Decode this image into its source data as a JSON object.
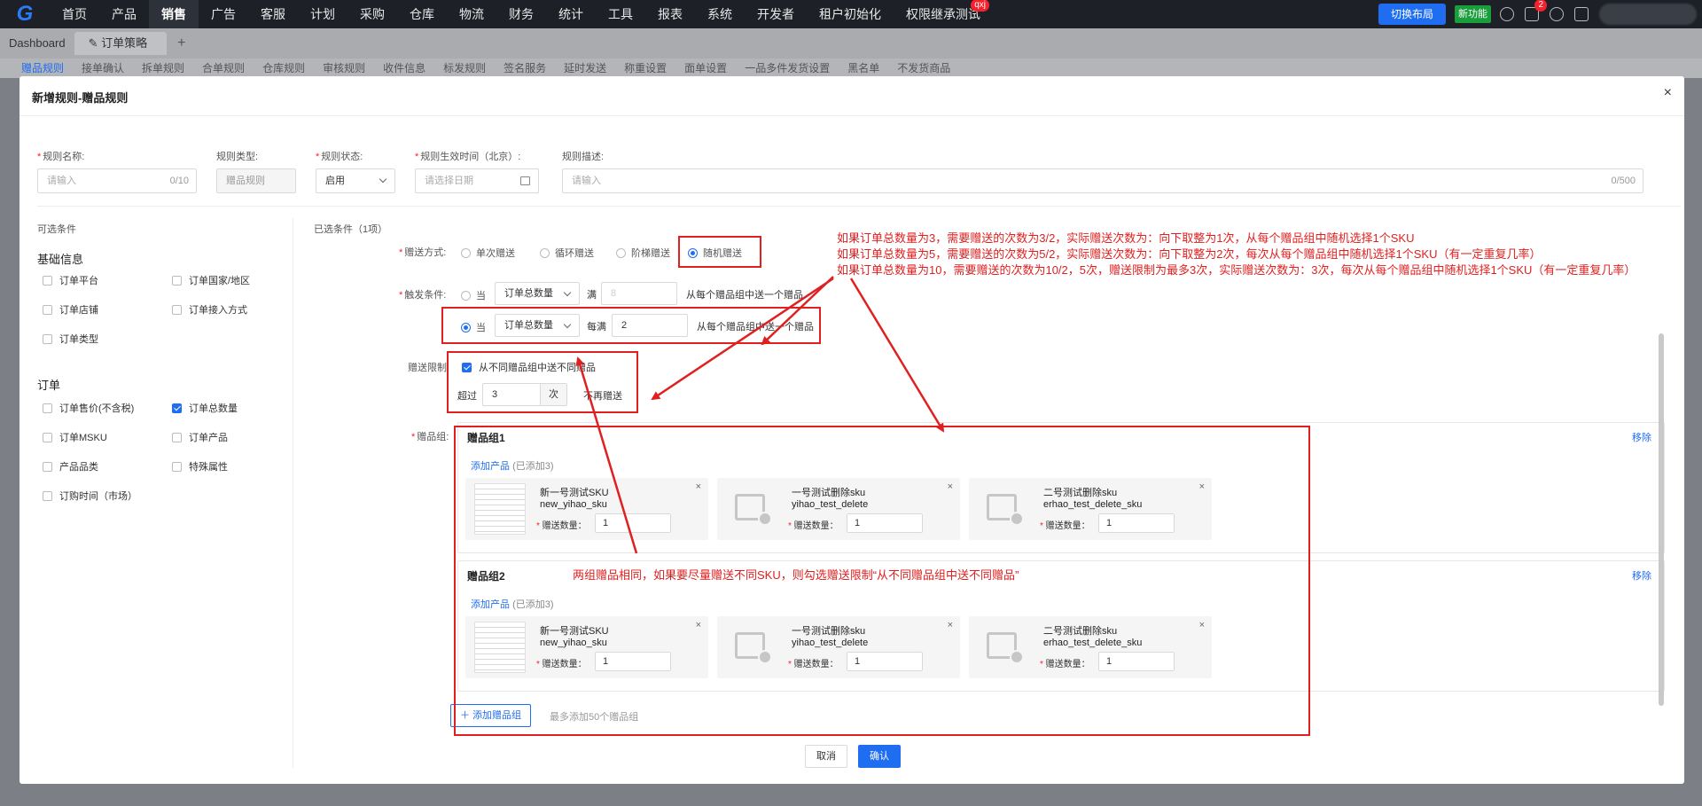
{
  "topnav": {
    "items": [
      "首页",
      "产品",
      "销售",
      "广告",
      "客服",
      "计划",
      "采购",
      "仓库",
      "物流",
      "财务",
      "统计",
      "工具",
      "报表",
      "系统",
      "开发者",
      "租户初始化",
      "权限继承测试"
    ],
    "active_index": 2,
    "badge_label": "qxj",
    "switch_layout_label": "切换布局",
    "new_feature_label": "新功能",
    "notify_count": "2"
  },
  "tabs": {
    "items": [
      "Dashboard",
      "订单策略"
    ],
    "active_index": 1,
    "add_label": "+"
  },
  "subtabs": [
    "赠品规则",
    "接单确认",
    "拆单规则",
    "合单规则",
    "仓库规则",
    "审核规则",
    "收件信息",
    "标发规则",
    "签名服务",
    "延时发送",
    "称重设置",
    "面单设置",
    "一品多件发货设置",
    "黑名单",
    "不发货商品"
  ],
  "modal": {
    "title": "新增规则-赠品规则",
    "close_label": "×",
    "fields": {
      "rule_name": {
        "label": "规则名称:",
        "placeholder": "请输入",
        "counter": "0/10"
      },
      "rule_type": {
        "label": "规则类型:",
        "value": "赠品规则"
      },
      "rule_status": {
        "label": "规则状态:",
        "value": "启用"
      },
      "effective_time": {
        "label": "规则生效时间（北京）:",
        "placeholder": "请选择日期"
      },
      "rule_desc": {
        "label": "规则描述:",
        "placeholder": "请输入",
        "counter": "0/500"
      }
    },
    "sidebar": {
      "title": "可选条件",
      "groups": [
        {
          "name": "基础信息",
          "items": [
            {
              "label": "订单平台",
              "checked": false
            },
            {
              "label": "订单国家/地区",
              "checked": false
            },
            {
              "label": "订单店铺",
              "checked": false
            },
            {
              "label": "订单接入方式",
              "checked": false
            },
            {
              "label": "订单类型",
              "checked": false
            }
          ]
        },
        {
          "name": "订单",
          "items": [
            {
              "label": "订单售价(不含税)",
              "checked": false
            },
            {
              "label": "订单总数量",
              "checked": true
            },
            {
              "label": "订单MSKU",
              "checked": false
            },
            {
              "label": "订单产品",
              "checked": false
            },
            {
              "label": "产品品类",
              "checked": false
            },
            {
              "label": "特殊属性",
              "checked": false
            },
            {
              "label": "订购时间（市场）",
              "checked": false
            }
          ]
        }
      ]
    },
    "selected_title": "已选条件（1项）",
    "gift_mode": {
      "label": "赠送方式:",
      "options": [
        "单次赠送",
        "循环赠送",
        "阶梯赠送",
        "随机赠送"
      ],
      "selected": "随机赠送"
    },
    "trigger": {
      "label": "触发条件:",
      "row1": {
        "when": "当",
        "field": "订单总数量",
        "op": "满",
        "value": "8",
        "suffix": "从每个赠品组中送一个赠品"
      },
      "row2": {
        "when": "当",
        "field": "订单总数量",
        "op": "每满",
        "value": "2",
        "suffix": "从每个赠品组中送一个赠品"
      }
    },
    "limit": {
      "label": "赠送限制:",
      "checkbox_label": "从不同赠品组中送不同赠品",
      "checked": true,
      "exceed_label": "超过",
      "value": "3",
      "unit": "次",
      "suffix": "不再赠送"
    },
    "groups_label": "赠品组:",
    "gift_groups": [
      {
        "title": "赠品组1",
        "remove": "移除",
        "add_label": "添加产品",
        "added": "(已添加3)",
        "products": [
          {
            "name": "新一号测试SKU",
            "sku": "new_yihao_sku",
            "qty_label": "赠送数量：",
            "qty": "1",
            "img": "thumb"
          },
          {
            "name": "一号测试删除sku",
            "sku": "yihao_test_delete",
            "qty_label": "赠送数量：",
            "qty": "1",
            "img": "placeholder"
          },
          {
            "name": "二号测试删除sku",
            "sku": "erhao_test_delete_sku",
            "qty_label": "赠送数量：",
            "qty": "1",
            "img": "placeholder"
          }
        ]
      },
      {
        "title": "赠品组2",
        "remove": "移除",
        "add_label": "添加产品",
        "added": "(已添加3)",
        "products": [
          {
            "name": "新一号测试SKU",
            "sku": "new_yihao_sku",
            "qty_label": "赠送数量：",
            "qty": "1",
            "img": "thumb"
          },
          {
            "name": "一号测试删除sku",
            "sku": "yihao_test_delete",
            "qty_label": "赠送数量：",
            "qty": "1",
            "img": "placeholder"
          },
          {
            "name": "二号测试删除sku",
            "sku": "erhao_test_delete_sku",
            "qty_label": "赠送数量：",
            "qty": "1",
            "img": "placeholder"
          }
        ]
      }
    ],
    "add_group_label": "添加赠品组",
    "add_group_hint": "最多添加50个赠品组",
    "cancel_label": "取消",
    "ok_label": "确认"
  },
  "annotations": {
    "lines": [
      "如果订单总数量为3，需要赠送的次数为3/2，实际赠送次数为：向下取整为1次，从每个赠品组中随机选择1个SKU",
      "如果订单总数量为5，需要赠送的次数为5/2，实际赠送次数为：向下取整为2次，每次从每个赠品组中随机选择1个SKU（有一定重复几率）",
      "如果订单总数量为10，需要赠送的次数为10/2，5次，赠送限制为最多3次，实际赠送次数为：3次，每次从每个赠品组中随机选择1个SKU（有一定重复几率）"
    ],
    "bottom_note": "两组赠品相同，如果要尽量赠送不同SKU，则勾选赠送限制“从不同赠品组中送不同赠品”"
  },
  "colors": {
    "primary": "#1f6df1",
    "annotation_red": "#e02020",
    "nav_bg": "#1d2027",
    "new_feature_green": "#1a9e3c"
  }
}
